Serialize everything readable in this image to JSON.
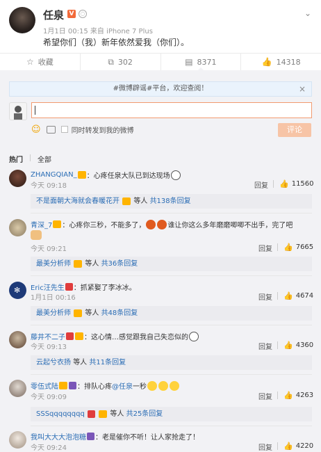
{
  "post": {
    "username": "任泉",
    "vip_badge": "V",
    "meta": "1月1日 00:15 来自 iPhone 7 Plus",
    "content": "希望你们（我）新年依然爱我（你们）。"
  },
  "actions": [
    {
      "icon": "star-icon",
      "glyph": "☆",
      "label": "收藏"
    },
    {
      "icon": "repost-icon",
      "glyph": "↗",
      "label": "302"
    },
    {
      "icon": "comment-icon",
      "glyph": "▭",
      "label": "8371"
    },
    {
      "icon": "like-icon",
      "glyph": "👍",
      "label": "14318"
    }
  ],
  "notice": {
    "text": "#微博辟谣#平台，欢迎查阅！",
    "close": "×"
  },
  "composer": {
    "forward_label": "同时转发到我的微博",
    "submit_label": "评论"
  },
  "filters": {
    "hot": "热门",
    "all": "全部"
  },
  "comments": [
    {
      "name": "ZHANGQIAN_",
      "text": "：心疼任泉大队已到达现场",
      "time": "今天 09:18",
      "reply": "回复",
      "likes": "11560",
      "sub": {
        "name": "不是面朝大海就会春暖花开",
        "mid": "等人",
        "tail": "共138条回复"
      }
    },
    {
      "name": "青深_7",
      "text": "：心疼你三秒，不能多了，",
      "text2": "谁让你这么多年磨磨唧唧不出手，完了吧",
      "time": "今天 09:21",
      "reply": "回复",
      "likes": "7665",
      "sub": {
        "name": "最美分析师",
        "mid": "等人",
        "tail": "共36条回复"
      }
    },
    {
      "name": "Eric汪先生",
      "text": "：抓紧娶了李冰冰。",
      "time": "1月1日 00:16",
      "reply": "回复",
      "likes": "4674",
      "sub": {
        "name": "最美分析师",
        "mid": "等人",
        "tail": "共48条回复"
      }
    },
    {
      "name": "藤井不二子",
      "text": "：这心情…感觉跟我自己失恋似的",
      "time": "今天 09:13",
      "reply": "回复",
      "likes": "4360",
      "sub": {
        "name": "云起兮衣扬",
        "mid": "等人",
        "tail": "共11条回复"
      }
    },
    {
      "name": "零伍式陆",
      "text": "：排队心疼",
      "mention": "@任泉",
      "text3": " 一秒",
      "time": "今天 09:09",
      "reply": "回复",
      "likes": "4263",
      "sub": {
        "name": "SSSqqqqqqqq",
        "mid": "等人",
        "tail": "共25条回复"
      }
    },
    {
      "name": "我叫大大大泡泡糖",
      "text": "：老是催你不听！让人家抢走了！",
      "time": "今天 09:24",
      "reply": "回复",
      "likes": "4220"
    }
  ]
}
